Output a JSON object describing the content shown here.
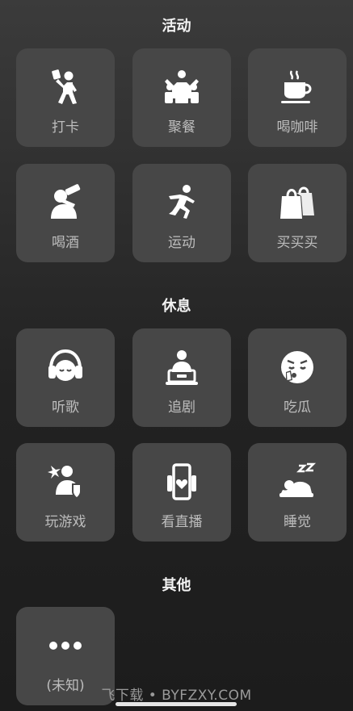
{
  "sections": [
    {
      "title": "活动"
    },
    {
      "title": "休息"
    },
    {
      "title": "其他"
    }
  ],
  "activity": {
    "items": [
      {
        "label": "打卡",
        "icon": "check-in-person-icon"
      },
      {
        "label": "聚餐",
        "icon": "group-dinner-icon"
      },
      {
        "label": "喝咖啡",
        "icon": "coffee-cup-icon"
      },
      {
        "label": "喝酒",
        "icon": "drinking-icon"
      },
      {
        "label": "运动",
        "icon": "running-icon"
      },
      {
        "label": "买买买",
        "icon": "shopping-bag-icon"
      }
    ]
  },
  "rest": {
    "items": [
      {
        "label": "听歌",
        "icon": "headphones-icon"
      },
      {
        "label": "追剧",
        "icon": "watching-tv-icon"
      },
      {
        "label": "吃瓜",
        "icon": "gossip-face-icon"
      },
      {
        "label": "玩游戏",
        "icon": "gaming-icon"
      },
      {
        "label": "看直播",
        "icon": "live-stream-icon"
      },
      {
        "label": "睡觉",
        "icon": "sleeping-icon"
      }
    ]
  },
  "other": {
    "items": [
      {
        "label": "(未知)",
        "icon": "more-dots-icon"
      }
    ]
  },
  "watermark": "飞下载 • BYFZXY.COM",
  "colors": {
    "tile_bg": "#474747",
    "label": "#bdbdbd",
    "title": "#f2f2f2"
  }
}
